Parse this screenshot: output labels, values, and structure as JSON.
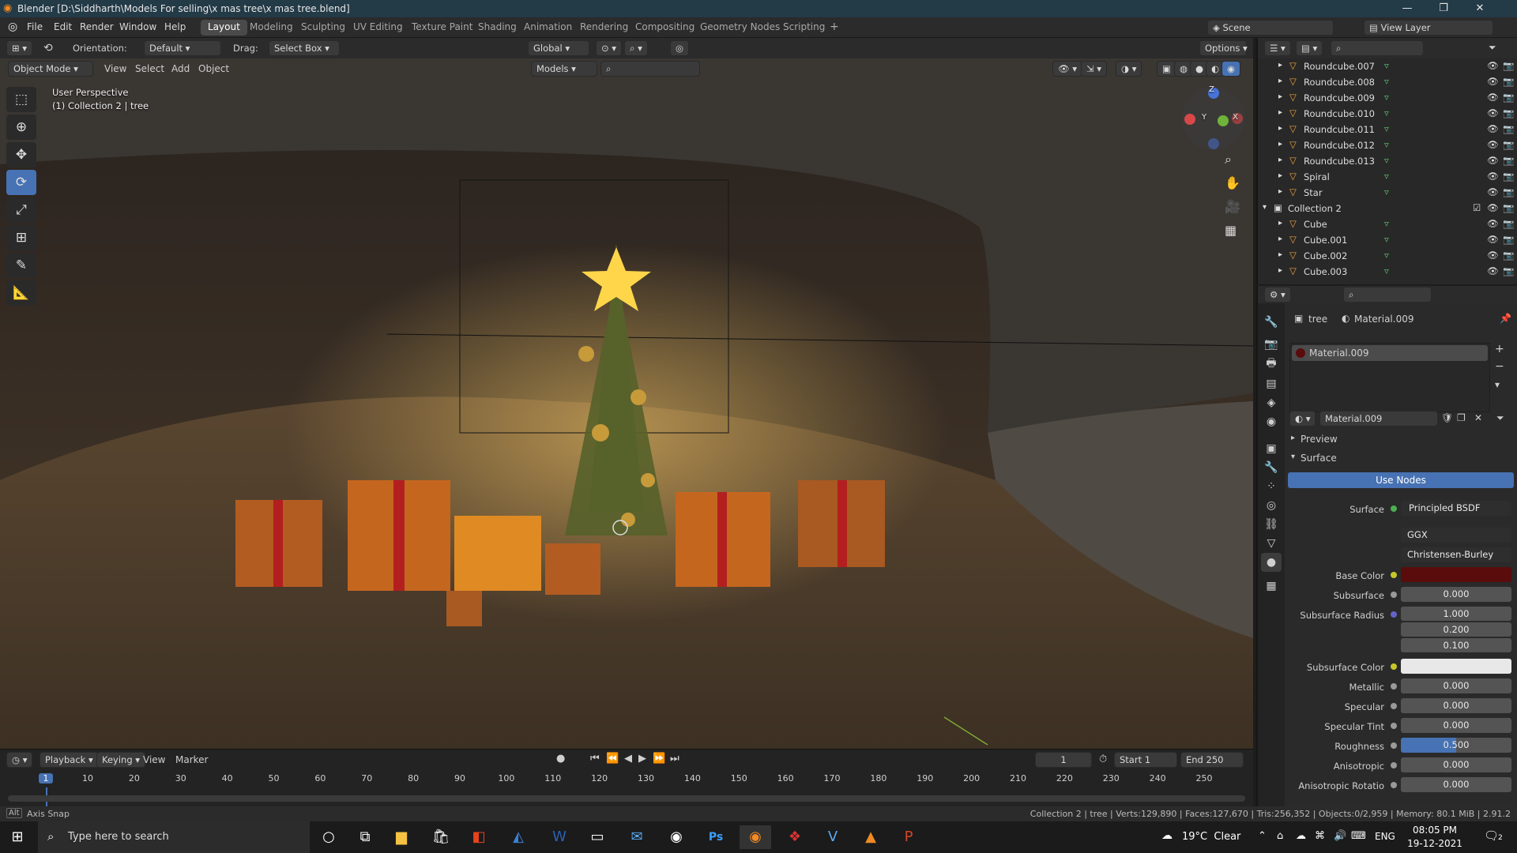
{
  "window": {
    "title": "Blender [D:\\Siddharth\\Models For selling\\x mas tree\\x mas tree.blend]"
  },
  "menu": [
    "File",
    "Edit",
    "Render",
    "Window",
    "Help"
  ],
  "workspaces": [
    "Layout",
    "Modeling",
    "Sculpting",
    "UV Editing",
    "Texture Paint",
    "Shading",
    "Animation",
    "Rendering",
    "Compositing",
    "Geometry Nodes",
    "Scripting"
  ],
  "scene": {
    "name": "Scene",
    "view_layer": "View Layer"
  },
  "header": {
    "orientation_label": "Orientation:",
    "orientation_value": "Default",
    "drag_label": "Drag:",
    "drag_value": "Select Box",
    "transform_space": "Global",
    "options": "Options",
    "mode": "Object Mode",
    "view": "View",
    "select": "Select",
    "add": "Add",
    "object": "Object",
    "collection_filter": "Models"
  },
  "viewport": {
    "perspective": "User Perspective",
    "selection": "(1) Collection 2 | tree",
    "gizmo": {
      "x": "X",
      "y": "Y",
      "z": "Z"
    }
  },
  "outliner": {
    "items": [
      {
        "name": "Roundcube.007",
        "indent": 1
      },
      {
        "name": "Roundcube.008",
        "indent": 1
      },
      {
        "name": "Roundcube.009",
        "indent": 1
      },
      {
        "name": "Roundcube.010",
        "indent": 1
      },
      {
        "name": "Roundcube.011",
        "indent": 1
      },
      {
        "name": "Roundcube.012",
        "indent": 1
      },
      {
        "name": "Roundcube.013",
        "indent": 1
      },
      {
        "name": "Spiral",
        "indent": 1
      },
      {
        "name": "Star",
        "indent": 1
      },
      {
        "name": "Collection 2",
        "indent": 0
      },
      {
        "name": "Cube",
        "indent": 1
      },
      {
        "name": "Cube.001",
        "indent": 1
      },
      {
        "name": "Cube.002",
        "indent": 1
      },
      {
        "name": "Cube.003",
        "indent": 1
      }
    ]
  },
  "properties": {
    "object": "tree",
    "material": "Material.009",
    "slot": "Material.009",
    "preview": "Preview",
    "surface_section": "Surface",
    "use_nodes": "Use Nodes",
    "surface_label": "Surface",
    "surface_value": "Principled BSDF",
    "distribution": "GGX",
    "subsurface_method": "Christensen-Burley",
    "base_color_label": "Base Color",
    "base_color": "#5a0c0c",
    "subsurface_label": "Subsurface",
    "subsurface": "0.000",
    "subsurface_radius_label": "Subsurface Radius",
    "subsurface_radius": [
      "1.000",
      "0.200",
      "0.100"
    ],
    "subsurface_color_label": "Subsurface Color",
    "subsurface_color": "#e8e8e8",
    "metallic_label": "Metallic",
    "metallic": "0.000",
    "specular_label": "Specular",
    "specular": "0.000",
    "specular_tint_label": "Specular Tint",
    "specular_tint": "0.000",
    "roughness_label": "Roughness",
    "roughness": "0.500",
    "anisotropic_label": "Anisotropic",
    "anisotropic": "0.000",
    "anisotropic_rotation_label": "Anisotropic Rotatio",
    "anisotropic_rotation": "0.000"
  },
  "timeline": {
    "playback": "Playback",
    "keying": "Keying",
    "view": "View",
    "marker": "Marker",
    "current_frame": "1",
    "start_label": "Start",
    "start": "1",
    "end_label": "End",
    "end": "250",
    "ticks": [
      "1",
      "10",
      "20",
      "30",
      "40",
      "50",
      "60",
      "70",
      "80",
      "90",
      "100",
      "110",
      "120",
      "130",
      "140",
      "150",
      "160",
      "170",
      "180",
      "190",
      "200",
      "210",
      "220",
      "230",
      "240",
      "250"
    ]
  },
  "status": {
    "left": "Axis Snap",
    "right": "Collection 2 | tree | Verts:129,890 | Faces:127,670 | Tris:256,352 | Objects:0/2,959 | Memory: 80.1 MiB | 2.91.2"
  },
  "taskbar": {
    "search_placeholder": "Type here to search",
    "weather": "19°C  Clear",
    "lang": "ENG",
    "time": "08:05 PM",
    "date": "19-12-2021",
    "notifications": "2"
  },
  "colors": {
    "accent": "#4772b3",
    "active_tab": "#4a4a4a"
  }
}
